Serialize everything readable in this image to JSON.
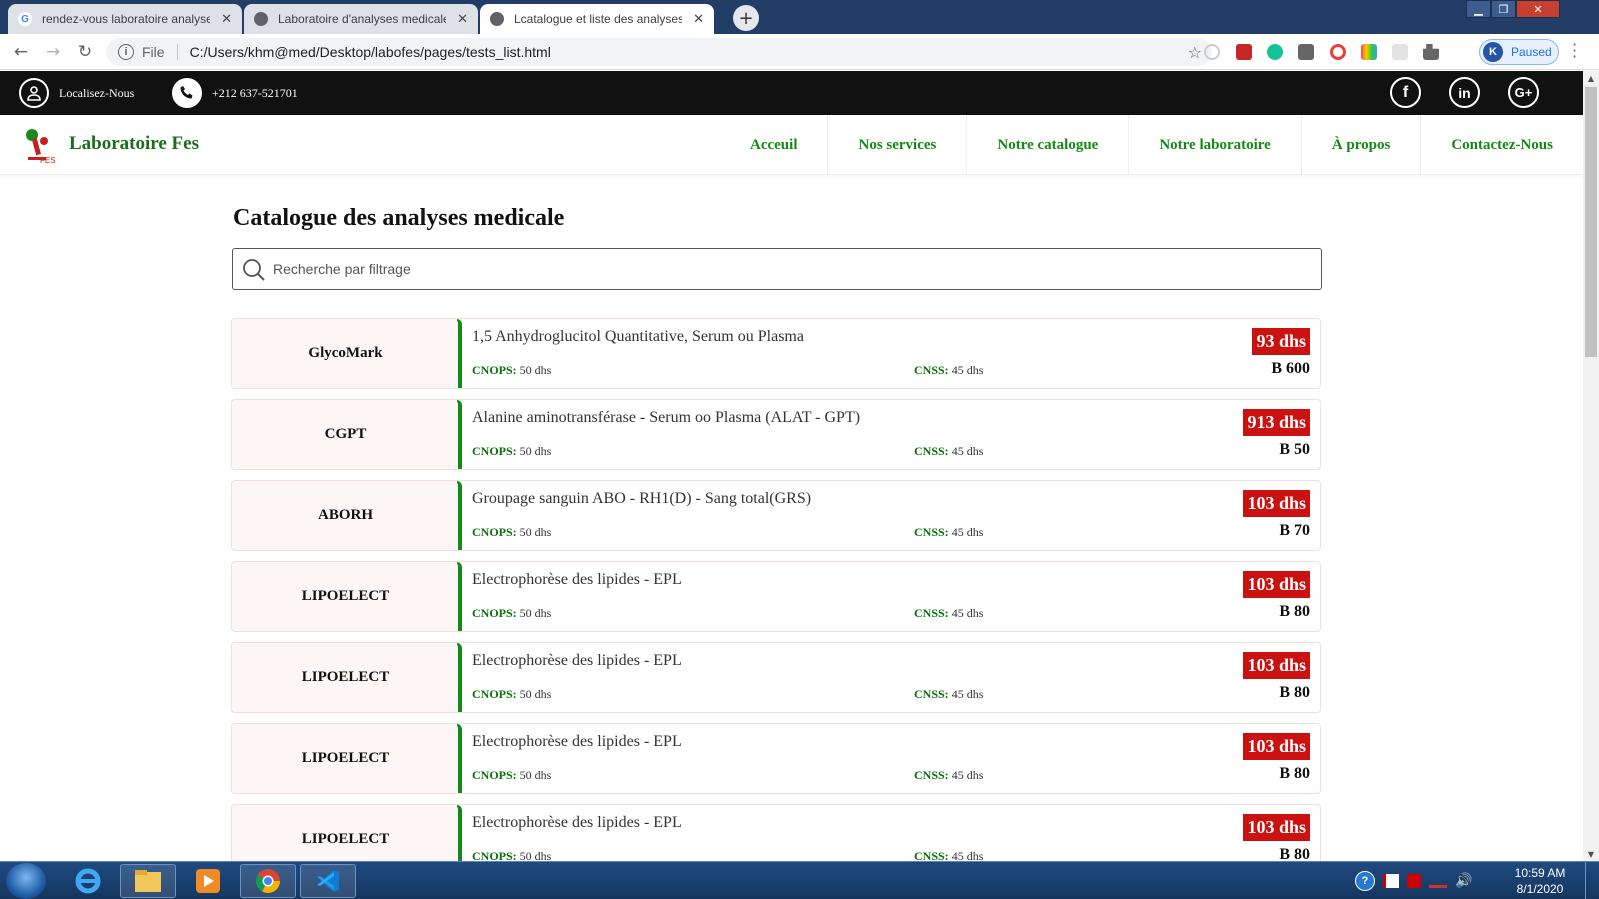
{
  "browser": {
    "tabs": [
      {
        "title": "rendez-vous laboratoire analyse",
        "icon": "google-icon",
        "active": false
      },
      {
        "title": "Laboratoire d'analyses medicales",
        "icon": "globe-icon",
        "active": false
      },
      {
        "title": "Lcatalogue et liste des analyses M",
        "icon": "globe-icon",
        "active": true
      }
    ],
    "address": {
      "scheme_label": "File",
      "url": "C:/Users/khm@med/Desktop/labofes/pages/tests_list.html"
    },
    "profile_label": "Paused"
  },
  "topbar": {
    "location_label": "Localisez-Nous",
    "phone": "+212 637-521701",
    "social": [
      {
        "name": "facebook-icon",
        "glyph": "f"
      },
      {
        "name": "linkedin-icon",
        "glyph": "in"
      },
      {
        "name": "google-plus-icon",
        "glyph": "G+"
      }
    ]
  },
  "header": {
    "brand": "Laboratoire Fes",
    "logo_text": "FES",
    "nav": [
      "Acceuil",
      "Nos services",
      "Notre catalogue",
      "Notre laboratoire",
      "À propos",
      "Contactez-Nous"
    ]
  },
  "main": {
    "title": "Catalogue des analyses medicale",
    "search_placeholder": "Recherche par filtrage",
    "tests": [
      {
        "code": "GlycoMark",
        "name": "1,5 Anhydroglucitol Quantitative, Serum ou Plasma",
        "cnops_label": "CNOPS:",
        "cnops": "50 dhs",
        "cnss_label": "CNSS:",
        "cnss": "45 dhs",
        "price": "93 dhs",
        "b": "B 600"
      },
      {
        "code": "CGPT",
        "name": "Alanine aminotransférase - Serum oo Plasma (ALAT - GPT)",
        "cnops_label": "CNOPS:",
        "cnops": "50 dhs",
        "cnss_label": "CNSS:",
        "cnss": "45 dhs",
        "price": "913 dhs",
        "b": "B 50"
      },
      {
        "code": "ABORH",
        "name": "Groupage sanguin ABO - RH1(D) - Sang total(GRS)",
        "cnops_label": "CNOPS:",
        "cnops": "50 dhs",
        "cnss_label": "CNSS:",
        "cnss": "45 dhs",
        "price": "103 dhs",
        "b": "B 70"
      },
      {
        "code": "LIPOELECT",
        "name": "Electrophorèse des lipides - EPL",
        "cnops_label": "CNOPS:",
        "cnops": "50 dhs",
        "cnss_label": "CNSS:",
        "cnss": "45 dhs",
        "price": "103 dhs",
        "b": "B 80"
      },
      {
        "code": "LIPOELECT",
        "name": "Electrophorèse des lipides - EPL",
        "cnops_label": "CNOPS:",
        "cnops": "50 dhs",
        "cnss_label": "CNSS:",
        "cnss": "45 dhs",
        "price": "103 dhs",
        "b": "B 80"
      },
      {
        "code": "LIPOELECT",
        "name": "Electrophorèse des lipides - EPL",
        "cnops_label": "CNOPS:",
        "cnops": "50 dhs",
        "cnss_label": "CNSS:",
        "cnss": "45 dhs",
        "price": "103 dhs",
        "b": "B 80"
      },
      {
        "code": "LIPOELECT",
        "name": "Electrophorèse des lipides - EPL",
        "cnops_label": "CNOPS:",
        "cnops": "50 dhs",
        "cnss_label": "CNSS:",
        "cnss": "45 dhs",
        "price": "103 dhs",
        "b": "B 80"
      }
    ]
  },
  "taskbar": {
    "apps": [
      "internet-explorer-icon",
      "file-explorer-icon",
      "media-player-icon",
      "chrome-icon",
      "vscode-icon"
    ],
    "time": "10:59 AM",
    "date": "8/1/2020"
  },
  "colors": {
    "accent_green": "#138a13",
    "price_red": "#cc1111",
    "topbar": "#111111"
  }
}
